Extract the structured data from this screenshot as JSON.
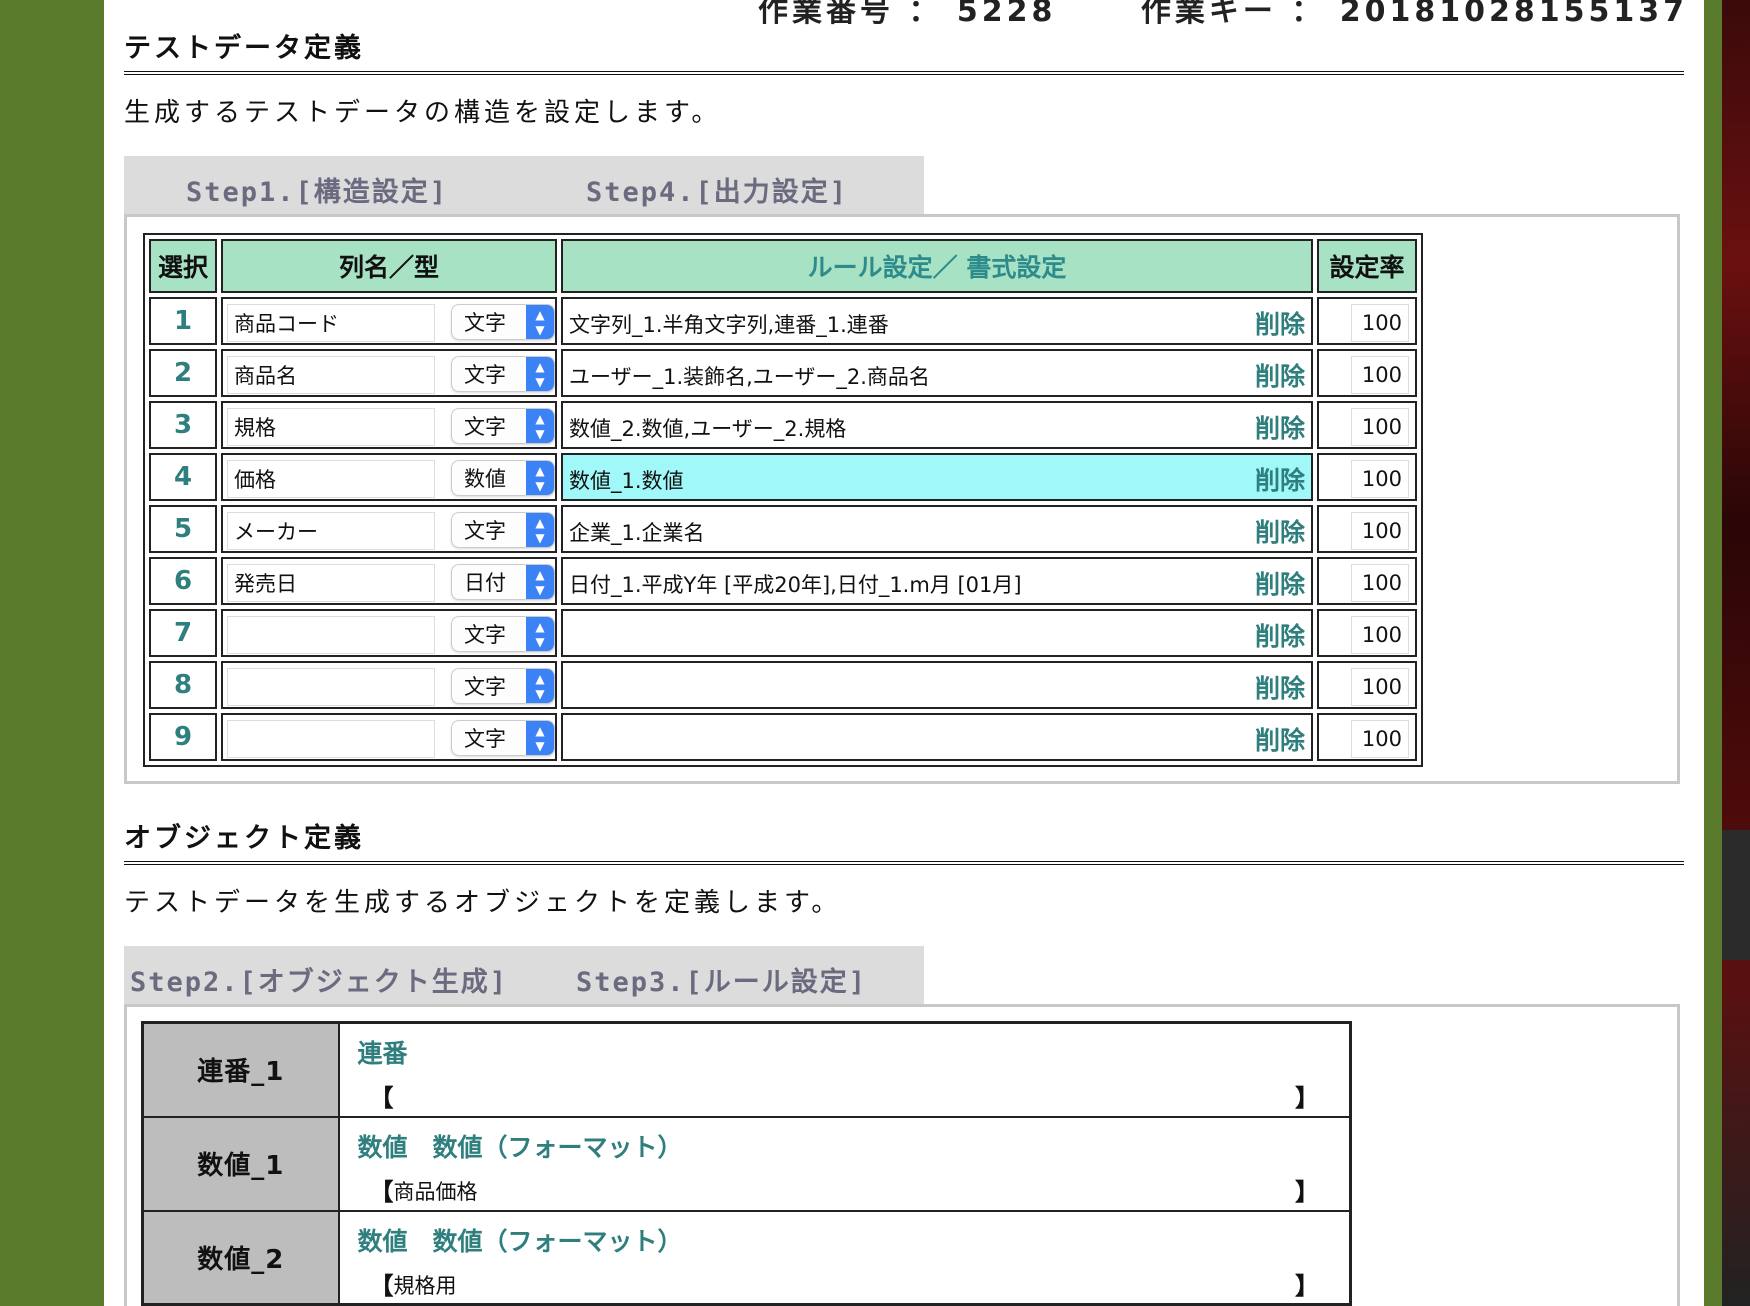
{
  "header": {
    "job_number_label": "作業番号 ： 5228",
    "job_key_label": "作業キー ： 20181028155137"
  },
  "testdata": {
    "title": "テストデータ定義",
    "description": "生成するテストデータの構造を設定します。",
    "tabs": [
      "Step1.[構造設定]",
      "Step4.[出力設定]"
    ],
    "columns": [
      "選択",
      "列名／型",
      "ルール設定／ 書式設定",
      "設定率"
    ],
    "delete_label": "削除",
    "rows": [
      {
        "no": "1",
        "name": "商品コード",
        "type": "文字",
        "rule": "文字列_1.半角文字列,連番_1.連番",
        "rate": "100"
      },
      {
        "no": "2",
        "name": "商品名",
        "type": "文字",
        "rule": "ユーザー_1.装飾名,ユーザー_2.商品名",
        "rate": "100"
      },
      {
        "no": "3",
        "name": "規格",
        "type": "文字",
        "rule": "数値_2.数値,ユーザー_2.規格",
        "rate": "100"
      },
      {
        "no": "4",
        "name": "価格",
        "type": "数値",
        "rule": "数値_1.数値",
        "rate": "100"
      },
      {
        "no": "5",
        "name": "メーカー",
        "type": "文字",
        "rule": "企業_1.企業名",
        "rate": "100"
      },
      {
        "no": "6",
        "name": "発売日",
        "type": "日付",
        "rule": "日付_1.平成Y年 [平成20年],日付_1.m月 [01月]",
        "rate": "100"
      },
      {
        "no": "7",
        "name": "",
        "type": "文字",
        "rule": "",
        "rate": "100"
      },
      {
        "no": "8",
        "name": "",
        "type": "文字",
        "rule": "",
        "rate": "100"
      },
      {
        "no": "9",
        "name": "",
        "type": "文字",
        "rule": "",
        "rate": "100"
      }
    ]
  },
  "objects": {
    "title": "オブジェクト定義",
    "description": "テストデータを生成するオブジェクトを定義します。",
    "tabs": [
      "Step2.[オブジェクト生成]",
      "Step3.[ルール設定]"
    ],
    "bracket_open": "【",
    "bracket_close": "】",
    "items": [
      {
        "name": "連番_1",
        "title": "連番",
        "desc": ""
      },
      {
        "name": "数値_1",
        "title": "数値　数値（フォーマット）",
        "desc": "商品価格"
      },
      {
        "name": "数値_2",
        "title": "数値　数値（フォーマット）",
        "desc": "規格用"
      }
    ]
  },
  "colors": {
    "background": "#5a7a2c",
    "header_cell": "#a8e2c4",
    "highlight_row": "#a0f8f8",
    "accent_text": "#2f7f7f",
    "tab_bar": "#dcdcdc",
    "object_name_cell": "#bdbdbd"
  }
}
